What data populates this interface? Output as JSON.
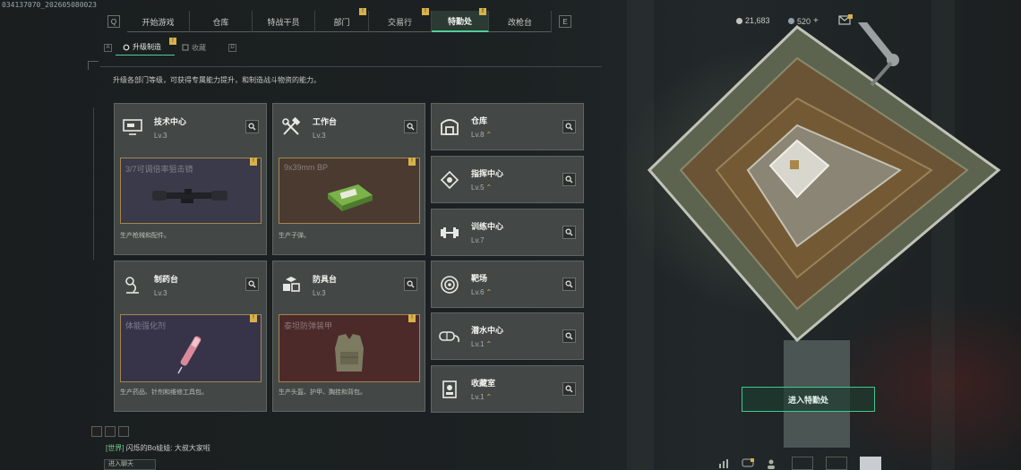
{
  "debug_id": "034137070_202605080023",
  "top_nav": {
    "tabs": [
      {
        "label": "开始游戏",
        "badge": ""
      },
      {
        "label": "仓库",
        "badge": ""
      },
      {
        "label": "特战干员",
        "badge": ""
      },
      {
        "label": "部门",
        "badge": "!"
      },
      {
        "label": "交易行",
        "badge": "!"
      },
      {
        "label": "特勤处",
        "badge": "!",
        "active": true
      },
      {
        "label": "改枪台",
        "badge": ""
      }
    ]
  },
  "currency": {
    "coins": "21,683",
    "tickets": "520"
  },
  "sub_nav": {
    "tabs": [
      {
        "label": "升级制造",
        "active": true
      },
      {
        "label": "收藏",
        "active": false
      }
    ]
  },
  "description": "升级各部门等级，可获得专属能力提升，和制造战斗物资的能力。",
  "production_facilities": [
    {
      "title": "技术中心",
      "level": "Lv.3",
      "product": "3/7可调倍率狙击镜",
      "caption": "生产枪械和配件。",
      "product_type": "gun"
    },
    {
      "title": "工作台",
      "level": "Lv.3",
      "product": "9x39mm BP",
      "caption": "生产子弹。",
      "product_type": "ammo"
    },
    {
      "title": "制药台",
      "level": "Lv.3",
      "product": "体能强化剂",
      "caption": "生产药品、针剂和维修工具包。",
      "product_type": "med"
    },
    {
      "title": "防具台",
      "level": "Lv.3",
      "product": "泰坦防弹装甲",
      "caption": "生产头盔、护甲、胸挂和背包。",
      "product_type": "armor"
    }
  ],
  "support_facilities": [
    {
      "title": "仓库",
      "level": "Lv.8",
      "upgrade": true,
      "icon": "warehouse-icon"
    },
    {
      "title": "指挥中心",
      "level": "Lv.5",
      "upgrade": true,
      "icon": "command-icon"
    },
    {
      "title": "训练中心",
      "level": "Lv.7",
      "upgrade": false,
      "icon": "dumbbell-icon"
    },
    {
      "title": "靶场",
      "level": "Lv.6",
      "upgrade": true,
      "icon": "target-icon"
    },
    {
      "title": "潜水中心",
      "level": "Lv.1",
      "upgrade": true,
      "icon": "diving-icon"
    },
    {
      "title": "收藏室",
      "level": "Lv.1",
      "upgrade": true,
      "icon": "collection-icon"
    }
  ],
  "enter_button": "进入特勤处",
  "chat": {
    "channel": "[世界]",
    "message": " 闪烁的Bo娃娃: 大叔大家啦",
    "input_placeholder": "进入聊天"
  },
  "colors": {
    "accent_green": "#4fcf98",
    "badge_yellow": "#d8b24a",
    "card_bg": "#464c4a"
  }
}
